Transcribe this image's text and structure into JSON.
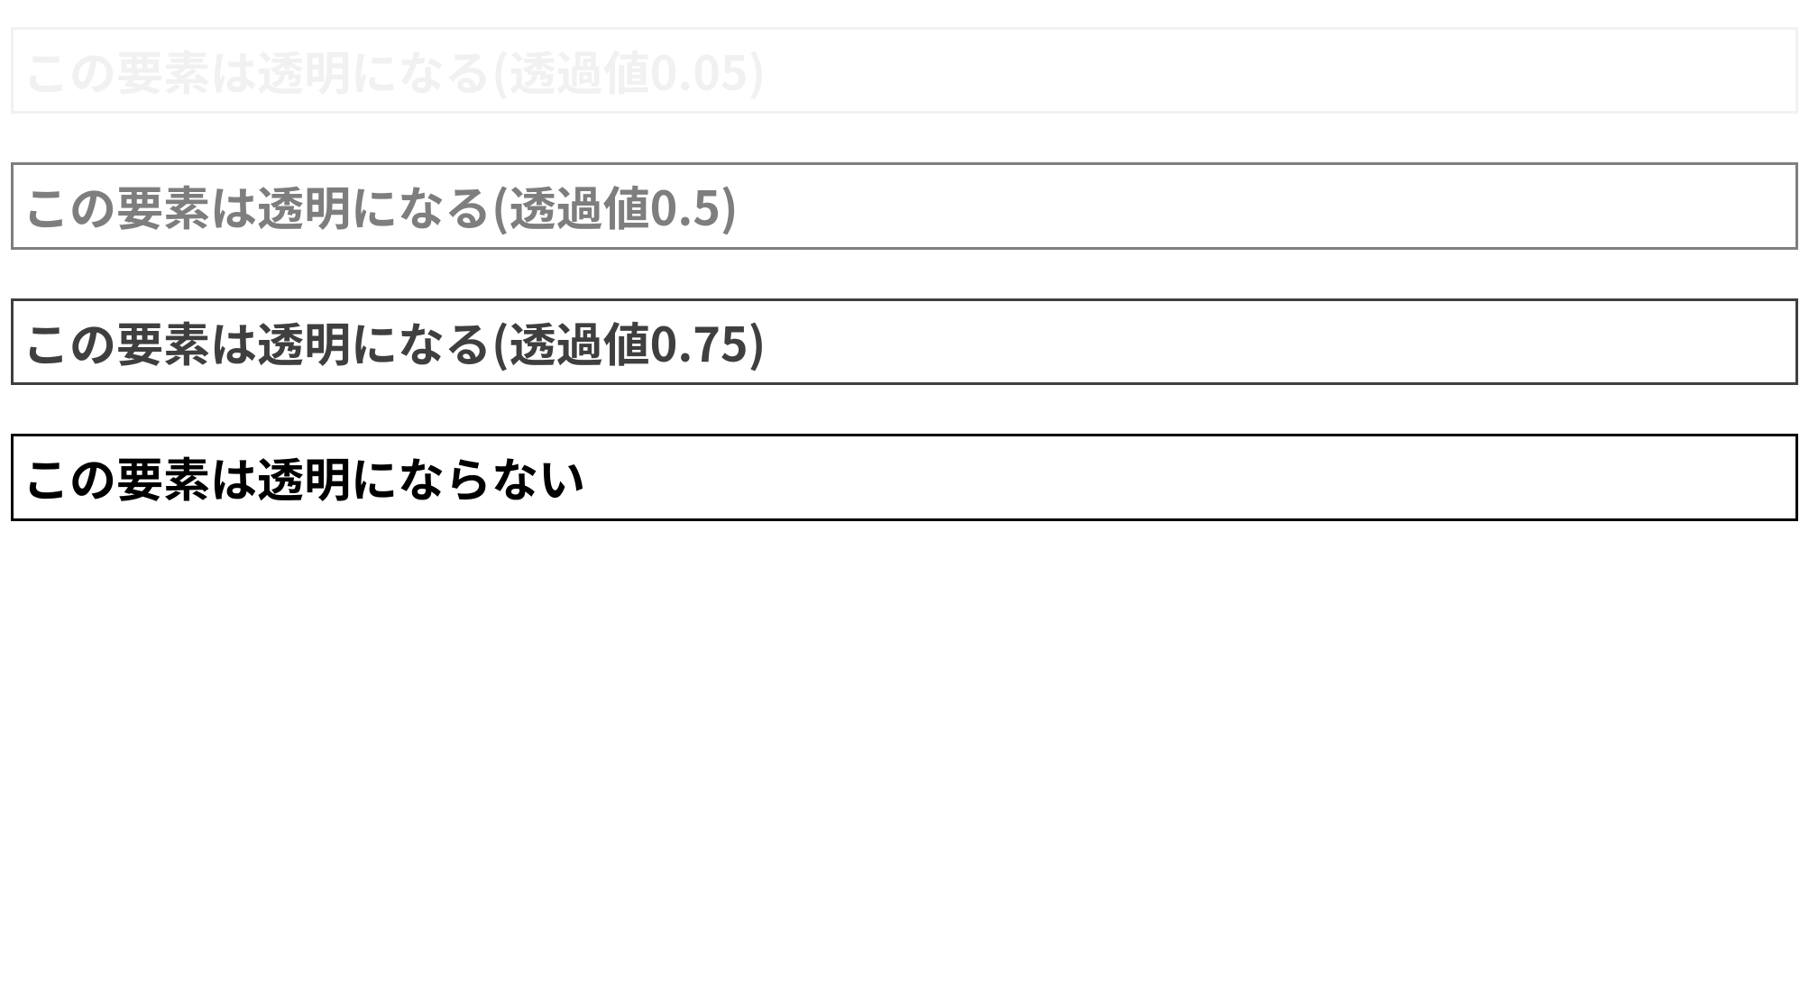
{
  "items": [
    {
      "text": "この要素は透明になる(透過値0.05)",
      "opacity": 0.05
    },
    {
      "text": "この要素は透明になる(透過値0.5)",
      "opacity": 0.5
    },
    {
      "text": "この要素は透明になる(透過値0.75)",
      "opacity": 0.75
    },
    {
      "text": "この要素は透明にならない",
      "opacity": 1.0
    }
  ]
}
